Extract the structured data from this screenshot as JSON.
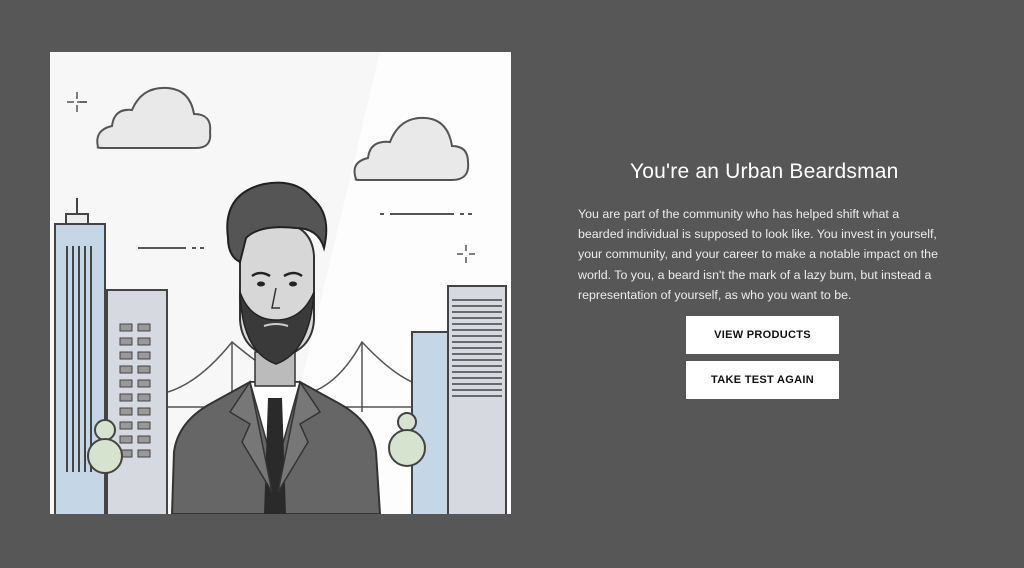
{
  "result": {
    "title": "You're an Urban Beardsman",
    "description": "You are part of the community who has helped shift what a bearded individual is supposed to look like. You invest in yourself, your community, and your career to make a notable impact on the world. To you, a beard isn't the mark of a lazy bum, but instead a representation of yourself, as who you want to be."
  },
  "actions": {
    "view_products_label": "VIEW  PRODUCTS",
    "take_test_again_label": "TAKE TEST AGAIN"
  },
  "illustration": {
    "subject": "urban-beardsman",
    "colors": {
      "background": "#f7f7f7",
      "building_blue": "#c5d6e6",
      "building_gray": "#d6d9e0",
      "tree_green": "#d5e3cf",
      "outline": "#444444"
    }
  },
  "colors": {
    "page_background": "#575757",
    "button_background": "#ffffff",
    "text": "#ffffff"
  }
}
